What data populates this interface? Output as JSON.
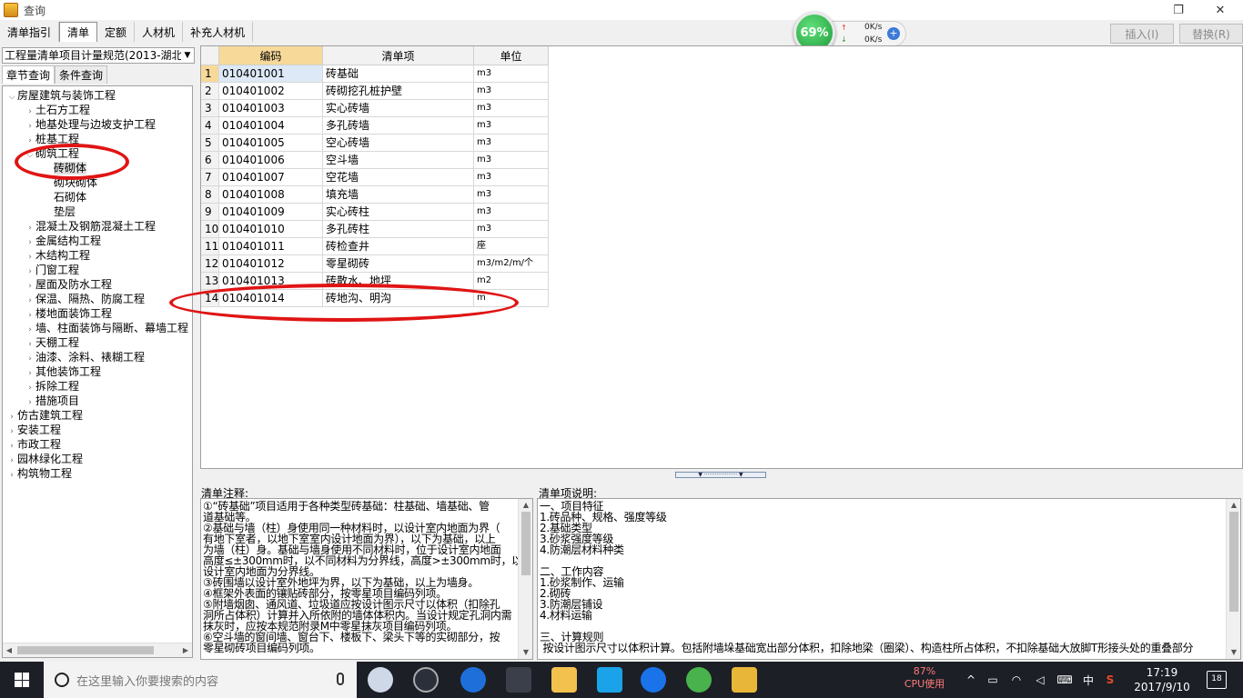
{
  "window": {
    "title": "查询",
    "restore_icon": "restore-icon",
    "close_icon": "close-icon"
  },
  "toolbar": {
    "tabs": [
      "清单指引",
      "清单",
      "定额",
      "人材机",
      "补充人材机"
    ],
    "active_tab": "清单",
    "insert_label": "插入(I)",
    "replace_label": "替换(R)"
  },
  "net_widget": {
    "percent": "69%",
    "upload": "0K/s",
    "download": "0K/s"
  },
  "left": {
    "spec_select": "工程量清单项目计量规范(2013-湖北",
    "subtabs": [
      "章节查询",
      "条件查询"
    ],
    "active_subtab": "章节查询",
    "tree": [
      {
        "label": "房屋建筑与装饰工程",
        "level": 0,
        "toggle": "v"
      },
      {
        "label": "土石方工程",
        "level": 1,
        "toggle": ">"
      },
      {
        "label": "地基处理与边坡支护工程",
        "level": 1,
        "toggle": ">"
      },
      {
        "label": "桩基工程",
        "level": 1,
        "toggle": ">"
      },
      {
        "label": "砌筑工程",
        "level": 1,
        "toggle": "v"
      },
      {
        "label": "砖砌体",
        "level": 2,
        "toggle": "",
        "selected": true
      },
      {
        "label": "砌块砌体",
        "level": 2,
        "toggle": ""
      },
      {
        "label": "石砌体",
        "level": 2,
        "toggle": ""
      },
      {
        "label": "垫层",
        "level": 2,
        "toggle": ""
      },
      {
        "label": "混凝土及钢筋混凝土工程",
        "level": 1,
        "toggle": ">"
      },
      {
        "label": "金属结构工程",
        "level": 1,
        "toggle": ">"
      },
      {
        "label": "木结构工程",
        "level": 1,
        "toggle": ">"
      },
      {
        "label": "门窗工程",
        "level": 1,
        "toggle": ">"
      },
      {
        "label": "屋面及防水工程",
        "level": 1,
        "toggle": ">"
      },
      {
        "label": "保温、隔热、防腐工程",
        "level": 1,
        "toggle": ">"
      },
      {
        "label": "楼地面装饰工程",
        "level": 1,
        "toggle": ">"
      },
      {
        "label": "墙、柱面装饰与隔断、幕墙工程",
        "level": 1,
        "toggle": ">"
      },
      {
        "label": "天棚工程",
        "level": 1,
        "toggle": ">"
      },
      {
        "label": "油漆、涂料、裱糊工程",
        "level": 1,
        "toggle": ">"
      },
      {
        "label": "其他装饰工程",
        "level": 1,
        "toggle": ">"
      },
      {
        "label": "拆除工程",
        "level": 1,
        "toggle": ">"
      },
      {
        "label": "措施项目",
        "level": 1,
        "toggle": ">"
      },
      {
        "label": "仿古建筑工程",
        "level": 0,
        "toggle": ">"
      },
      {
        "label": "安装工程",
        "level": 0,
        "toggle": ">"
      },
      {
        "label": "市政工程",
        "level": 0,
        "toggle": ">"
      },
      {
        "label": "园林绿化工程",
        "level": 0,
        "toggle": ">"
      },
      {
        "label": "构筑物工程",
        "level": 0,
        "toggle": ">"
      }
    ]
  },
  "table": {
    "columns": [
      "编码",
      "清单项",
      "单位"
    ],
    "rows": [
      [
        "1",
        "010401001",
        "砖基础",
        "m3"
      ],
      [
        "2",
        "010401002",
        "砖砌挖孔桩护壁",
        "m3"
      ],
      [
        "3",
        "010401003",
        "实心砖墙",
        "m3"
      ],
      [
        "4",
        "010401004",
        "多孔砖墙",
        "m3"
      ],
      [
        "5",
        "010401005",
        "空心砖墙",
        "m3"
      ],
      [
        "6",
        "010401006",
        "空斗墙",
        "m3"
      ],
      [
        "7",
        "010401007",
        "空花墙",
        "m3"
      ],
      [
        "8",
        "010401008",
        "填充墙",
        "m3"
      ],
      [
        "9",
        "010401009",
        "实心砖柱",
        "m3"
      ],
      [
        "10",
        "010401010",
        "多孔砖柱",
        "m3"
      ],
      [
        "11",
        "010401011",
        "砖检查井",
        "座"
      ],
      [
        "12",
        "010401012",
        "零星砌砖",
        "m3/m2/m/个"
      ],
      [
        "13",
        "010401013",
        "砖散水、地坪",
        "m2"
      ],
      [
        "14",
        "010401014",
        "砖地沟、明沟",
        "m"
      ]
    ]
  },
  "notes": {
    "label": "清单注释:",
    "lines": [
      "①“砖基础”项目适用于各种类型砖基础：柱基础、墙基础、管",
      "道基础等。",
      "②基础与墙（柱）身使用同一种材料时，以设计室内地面为界（",
      "有地下室者，以地下室室内设计地面为界），以下为基础，以上",
      "为墙（柱）身。基础与墙身使用不同材料时，位于设计室内地面",
      "高度≤±300mm时，以不同材料为分界线，高度>±300mm时，以",
      "设计室内地面为分界线。",
      "③砖围墙以设计室外地坪为界，以下为基础，以上为墙身。",
      "④框架外表面的镶贴砖部分，按零星项目编码列项。",
      "⑤附墙烟囱、通风道、垃圾道应按设计图示尺寸以体积（扣除孔",
      "洞所占体积）计算并入所依附的墙体体积内。当设计规定孔洞内需",
      "抹灰时，应按本规范附录M中零星抹灰项目编码列项。",
      "⑥空斗墙的窗间墙、窗台下、楼板下、梁头下等的实砌部分，按",
      "零星砌砖项目编码列项。"
    ]
  },
  "desc": {
    "label": "清单项说明:",
    "lines": [
      "一、项目特征",
      "1.砖品种、规格、强度等级",
      "2.基础类型",
      "3.砂浆强度等级",
      "4.防潮层材料种类",
      "",
      "二、工作内容",
      "1.砂浆制作、运输",
      "2.砌砖",
      "3.防潮层铺设",
      "4.材料运输",
      "",
      "三、计算规则",
      " 按设计图示尺寸以体积计算。包括附墙垛基础宽出部分体积，扣除地梁（圈梁）、构造柱所占体积，不扣除基础大放脚T形接头处的重叠部分"
    ]
  },
  "taskbar": {
    "search_placeholder": "在这里输入你要搜索的内容",
    "cpu_percent": "87%",
    "cpu_label": "CPU使用",
    "ime": "中",
    "time": "17:19",
    "date": "2017/9/10",
    "notifications": "18"
  },
  "colors": {
    "annotation": "#e01414",
    "header_active": "#f7d99a",
    "selected_cell": "#dde9f7"
  }
}
